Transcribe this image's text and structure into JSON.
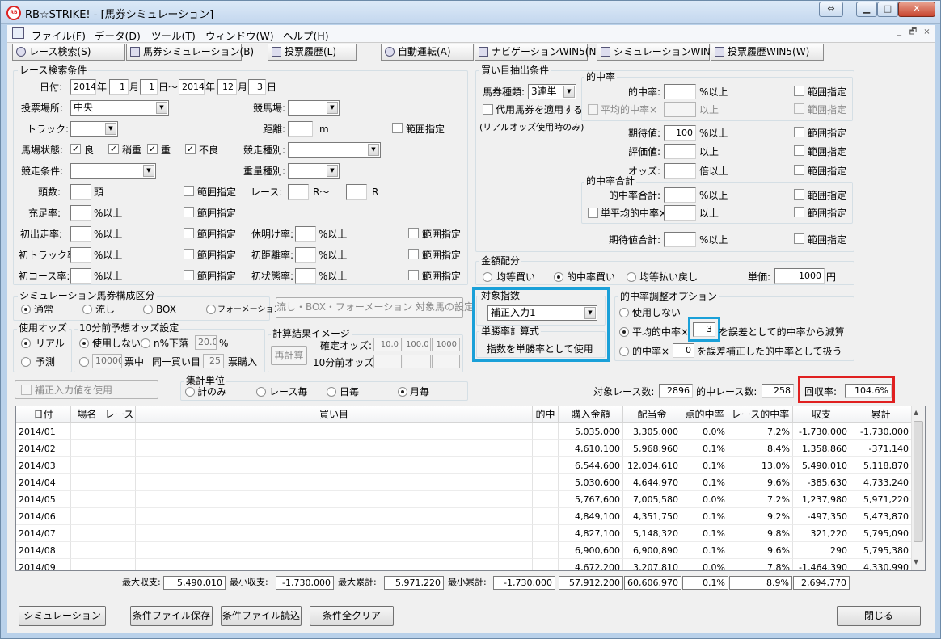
{
  "window": {
    "title": "RB☆STRIKE! - [馬券シミュレーション]",
    "icon": "app-logo-icon",
    "buttons": {
      "arrows": "⇔",
      "minimize": "▁",
      "maximize": "□",
      "close": "✕"
    }
  },
  "menu": [
    "ファイル(F)",
    "データ(D)",
    "ツール(T)",
    "ウィンドウ(W)",
    "ヘルプ(H)"
  ],
  "mdi": {
    "minimize": "_",
    "restore": "🗗",
    "close": "×"
  },
  "tabs": [
    {
      "label": "レース検索(S)",
      "icon": "search-icon"
    },
    {
      "label": "馬券シミュレーション(B)",
      "icon": "table-icon"
    },
    {
      "label": "投票履歴(L)",
      "icon": "document-icon"
    },
    {
      "label": "自動運転(A)",
      "icon": "clock-icon"
    },
    {
      "label": "ナビゲーションWIN5(N)",
      "icon": "navigation-icon"
    },
    {
      "label": "シミュレーションWIN5(I)",
      "icon": "table-icon"
    },
    {
      "label": "投票履歴WIN5(W)",
      "icon": "document-icon"
    }
  ],
  "race": {
    "title": "レース検索条件",
    "date_label": "日付:",
    "from": {
      "year": "2014",
      "month": "1",
      "day": "1"
    },
    "to": {
      "year": "2014",
      "month": "12",
      "day": "3"
    },
    "u_year": "年",
    "u_month": "月",
    "u_day": "日",
    "u_day_to": "日〜",
    "place_label": "投票場所:",
    "place_value": "中央",
    "course_label": "競馬場:",
    "course_value": "",
    "track_label": "トラック:",
    "track_value": "",
    "distance_label": "距離:",
    "distance_value": "",
    "distance_unit": "m",
    "range": "範囲指定",
    "cond_label": "馬場状態:",
    "cond_items": [
      "良",
      "稍重",
      "重",
      "不良"
    ],
    "type_label": "競走種別:",
    "type_value": "",
    "racecond_label": "競走条件:",
    "racecond_value": "",
    "weight_label": "重量種別:",
    "weight_value": "",
    "heads_label": "頭数:",
    "heads_unit": "頭",
    "race_label": "レース:",
    "race_from_unit": "R〜",
    "race_to_unit": "R",
    "fill_label": "充足率:",
    "pct_over": "%以上",
    "first_run_label": "初出走率:",
    "rest_label": "休明け率:",
    "first_track_label": "初トラック率:",
    "first_dist_label": "初距離率:",
    "first_course_label": "初コース率:",
    "first_cond_label": "初状態率:"
  },
  "compose": {
    "title": "シミュレーション馬券構成区分",
    "options": [
      "通常",
      "流し",
      "BOX",
      "フォーメーション"
    ],
    "selected": 0,
    "button": "流し・BOX・フォーメーション 対象馬の設定"
  },
  "odds": {
    "title": "使用オッズ",
    "options": [
      "リアル",
      "予測"
    ],
    "selected": 0
  },
  "pre10": {
    "title": "10分前予想オッズ設定",
    "none": "使用しない",
    "drop": "n%下落",
    "drop_value": "20.0",
    "drop_unit": "%",
    "count_value": "10000",
    "count_unit": "票中",
    "same_label": "同一買い目",
    "same_value": "25",
    "same_unit": "票購入"
  },
  "calc": {
    "title": "計算結果イメージ",
    "recalc": "再計算",
    "fixed_label": "確定オッズ:",
    "fixed_values": [
      "10.0",
      "100.0",
      "1000"
    ],
    "pre_label": "10分前オッズ:"
  },
  "corr_check": "補正入力値を使用",
  "unit": {
    "title": "集計単位",
    "options": [
      "計のみ",
      "レース毎",
      "日毎",
      "月毎"
    ],
    "selected": 3
  },
  "buy": {
    "title": "買い目抽出条件",
    "type_label": "馬券種類:",
    "type_value": "3連単",
    "substitute": "代用馬券を適用する",
    "substitute_note": "(リアルオッズ使用時のみ)",
    "hit_group": "的中率",
    "hit_label": "的中率:",
    "pct_over": "%以上",
    "range": "範囲指定",
    "avg_hit_label": "平均的中率×",
    "over": "以上",
    "expect_label": "期待値:",
    "expect_value": "100",
    "eval_label": "評価値:",
    "odds_label": "オッズ:",
    "odds_unit": "倍以上",
    "sum_group": "的中率合計",
    "sum_label": "的中率合計:",
    "single_avg_label": "単平均的中率×",
    "expect_sum_label": "期待値合計:"
  },
  "money": {
    "title": "金額配分",
    "options": [
      "均等買い",
      "的中率買い",
      "均等払い戻し"
    ],
    "selected": 1,
    "unit_label": "単価:",
    "unit_value": "1000",
    "yen": "円"
  },
  "target": {
    "title": "対象指数",
    "value": "補正入力1"
  },
  "winrate": {
    "title": "単勝率計算式",
    "text": "指数を単勝率として使用"
  },
  "adjust": {
    "title": "的中率調整オプション",
    "none": "使用しない",
    "avg_label": "平均的中率×",
    "avg_value": "3",
    "avg_suffix": "を誤差として的中率から減算",
    "hit_label": "的中率×",
    "hit_value": "0",
    "hit_suffix": "を誤差補正した的中率として扱う",
    "selected": 1
  },
  "stats": {
    "target_label": "対象レース数:",
    "target_value": "2896",
    "hit_label": "的中レース数:",
    "hit_value": "258",
    "rate_label": "回収率:",
    "rate_value": "104.6%"
  },
  "table": {
    "headers": [
      "日付",
      "場名",
      "レース",
      "買い目",
      "的中",
      "購入金額",
      "配当金",
      "点的中率",
      "レース的中率",
      "収支",
      "累計"
    ],
    "rows": [
      [
        "2014/01",
        "",
        "",
        "",
        "",
        "5,035,000",
        "3,305,000",
        "0.0%",
        "7.2%",
        "-1,730,000",
        "-1,730,000"
      ],
      [
        "2014/02",
        "",
        "",
        "",
        "",
        "4,610,100",
        "5,968,960",
        "0.1%",
        "8.4%",
        "1,358,860",
        "-371,140"
      ],
      [
        "2014/03",
        "",
        "",
        "",
        "",
        "6,544,600",
        "12,034,610",
        "0.1%",
        "13.0%",
        "5,490,010",
        "5,118,870"
      ],
      [
        "2014/04",
        "",
        "",
        "",
        "",
        "5,030,600",
        "4,644,970",
        "0.1%",
        "9.6%",
        "-385,630",
        "4,733,240"
      ],
      [
        "2014/05",
        "",
        "",
        "",
        "",
        "5,767,600",
        "7,005,580",
        "0.0%",
        "7.2%",
        "1,237,980",
        "5,971,220"
      ],
      [
        "2014/06",
        "",
        "",
        "",
        "",
        "4,849,100",
        "4,351,750",
        "0.1%",
        "9.2%",
        "-497,350",
        "5,473,870"
      ],
      [
        "2014/07",
        "",
        "",
        "",
        "",
        "4,827,100",
        "5,148,320",
        "0.1%",
        "9.8%",
        "321,220",
        "5,795,090"
      ],
      [
        "2014/08",
        "",
        "",
        "",
        "",
        "6,900,600",
        "6,900,890",
        "0.1%",
        "9.6%",
        "290",
        "5,795,380"
      ],
      [
        "2014/09",
        "",
        "",
        "",
        "",
        "4,672,200",
        "3,207,810",
        "0.0%",
        "7.8%",
        "-1,464,390",
        "4,330,990"
      ]
    ]
  },
  "summary": {
    "max_label": "最大収支:",
    "max_value": "5,490,010",
    "min_label": "最小収支:",
    "min_value": "-1,730,000",
    "max_cum_label": "最大累計:",
    "max_cum_value": "5,971,220",
    "min_cum_label": "最小累計:",
    "min_cum_value": "-1,730,000",
    "buy_total": "57,912,200",
    "pay_total": "60,606,970",
    "pt_rate": "0.1%",
    "race_rate": "8.9%",
    "balance": "2,694,770"
  },
  "bottom": {
    "simulate": "シミュレーション",
    "save": "条件ファイル保存",
    "load": "条件ファイル読込",
    "clear": "条件全クリア",
    "close": "閉じる"
  }
}
